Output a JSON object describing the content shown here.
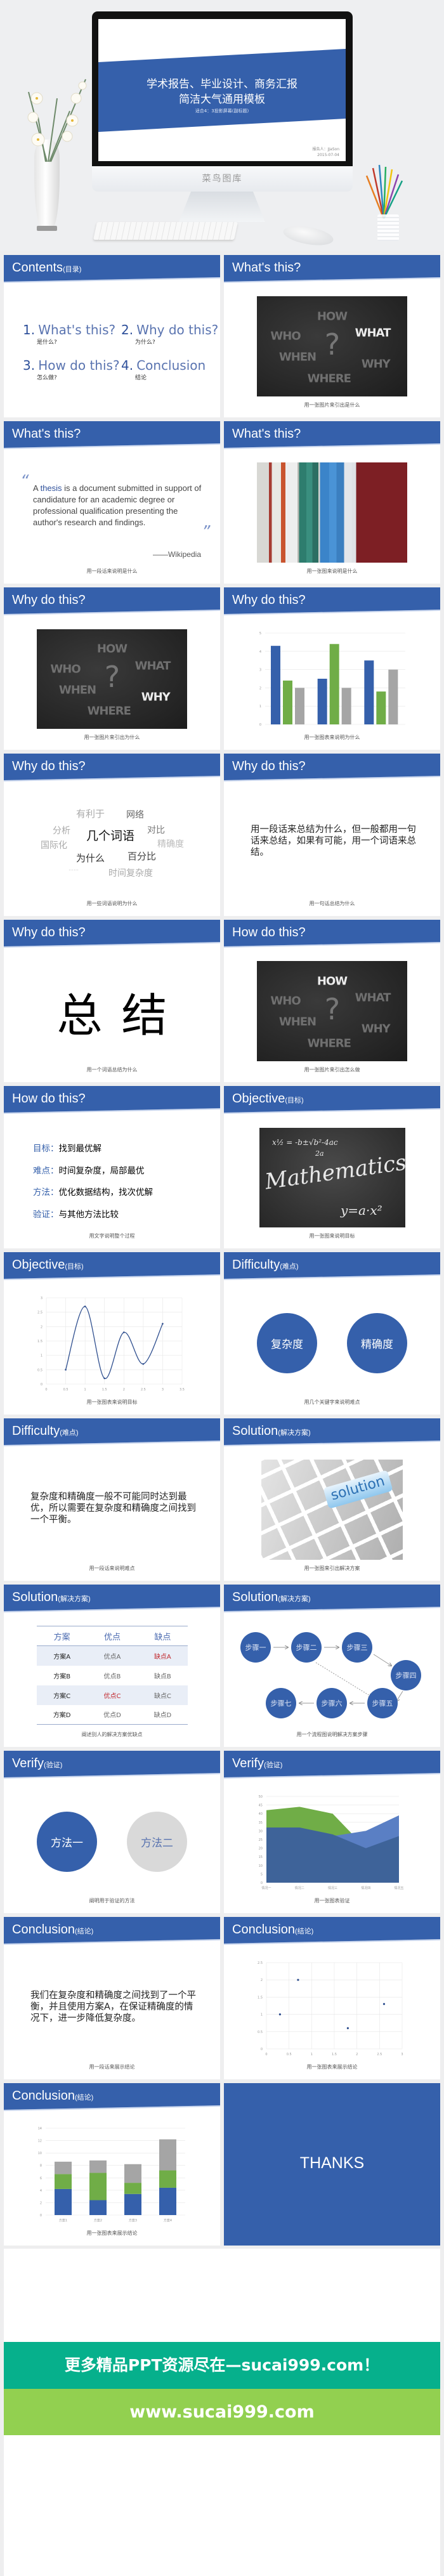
{
  "hero": {
    "title_line1": "学术报告、毕业设计、商务汇报",
    "title_line2": "简洁大气通用模板",
    "subtitle": "适合4：3投影屏幕(副标题)",
    "presenter": "报告人：JJaSon",
    "date": "2015-07-04",
    "brand": "菜鸟图库"
  },
  "colors": {
    "accent": "#3560ab",
    "green": "#70ad47",
    "gray": "#a5a5a5",
    "highlight_red": "#c0282d",
    "banner_teal": "#06b08c",
    "banner_lime": "#92d050"
  },
  "board_words": {
    "how": "HOW",
    "who": "WHO",
    "what": "WHAT",
    "when": "WHEN",
    "why": "WHY",
    "where": "WHERE",
    "q": "?"
  },
  "slides": [
    {
      "title": "Contents",
      "title_sub": "(目录)",
      "items": [
        {
          "num": "1.",
          "label": "What's this?",
          "sub": "是什么?"
        },
        {
          "num": "2.",
          "label": "Why do this?",
          "sub": "为什么?"
        },
        {
          "num": "3.",
          "label": "How do this?",
          "sub": "怎么做?"
        },
        {
          "num": "4.",
          "label": "Conclusion",
          "sub": "结论"
        }
      ]
    },
    {
      "title": "What's this?",
      "caption": "用一张图片来引出是什么"
    },
    {
      "title": "What's this?",
      "quote_open": "“",
      "quote_pre": "A ",
      "quote_term": "thesis",
      "quote_rest": " is a document submitted in support of candidature for an academic degree or professional qualification presenting the author's research and findings.",
      "quote_close": "”",
      "source": "——Wikipedia",
      "caption": "用一段话来说明是什么"
    },
    {
      "title": "What's this?",
      "caption": "用一张图来说明是什么"
    },
    {
      "title": "Why do this?",
      "caption": "用一张图片来引出为什么"
    },
    {
      "title": "Why do this?",
      "caption": "用一张图表来说明为什么"
    },
    {
      "title": "Why do this?",
      "caption": "用一些词语说明为什么",
      "words": [
        "有利于",
        "网络",
        "分析",
        "几个词语",
        "对比",
        "精确度",
        "国际化",
        "为什么",
        "百分比",
        "……",
        "时间复杂度"
      ]
    },
    {
      "title": "Why do this?",
      "paragraph": "用一段话来总结为什么，但一般都用一句话来总结，如果有可能，用一个词语来总结。",
      "caption": "用一句话总结为什么"
    },
    {
      "title": "Why do this?",
      "big_word": "总结",
      "caption": "用一个词语总结为什么"
    },
    {
      "title": "How do this?",
      "caption": "用一张图片来引出怎么做"
    },
    {
      "title": "How do this?",
      "list": [
        {
          "label": "目标：",
          "text": "找到最优解"
        },
        {
          "label": "难点：",
          "text": "时间复杂度，局部最优"
        },
        {
          "label": "方法：",
          "text": "优化数据结构，找次优解"
        },
        {
          "label": "验证：",
          "text": "与其他方法比较"
        }
      ],
      "caption": "用文字说明整个过程"
    },
    {
      "title": "Objective",
      "title_sub": "(目标)",
      "caption": "用一张图来说明目标",
      "board_text": {
        "formula1": "x½ = -b±√b²-4ac",
        "formula1b": "2a",
        "main": "Mathematics",
        "formula2": "y=a·x²"
      }
    },
    {
      "title": "Objective",
      "title_sub": "(目标)",
      "caption": "用一张图表来说明目标"
    },
    {
      "title": "Difficulty",
      "title_sub": "(难点)",
      "keywords": [
        "复杂度",
        "精确度"
      ],
      "caption": "用几个关键字来说明难点"
    },
    {
      "title": "Difficulty",
      "title_sub": "(难点)",
      "paragraph": "复杂度和精确度一般不可能同时达到最优，所以需要在复杂度和精确度之间找到一个平衡。",
      "caption": "用一段话来说明难点"
    },
    {
      "title": "Solution",
      "title_sub": "(解决方案)",
      "image_text": "solution",
      "caption": "用一张图来引出解决方案"
    },
    {
      "title": "Solution",
      "title_sub": "(解决方案)",
      "table": {
        "headers": [
          "方案",
          "优点",
          "缺点"
        ],
        "rows": [
          [
            "方案A",
            "优点A",
            "缺点A"
          ],
          [
            "方案B",
            "优点B",
            "缺点B"
          ],
          [
            "方案C",
            "优点C",
            "缺点C"
          ],
          [
            "方案D",
            "优点D",
            "缺点D"
          ]
        ]
      },
      "caption": "阐述别人的解决方案优缺点"
    },
    {
      "title": "Solution",
      "title_sub": "(解决方案)",
      "steps": [
        "步骤一",
        "步骤二",
        "步骤三",
        "步骤四",
        "步骤五",
        "步骤六",
        "步骤七"
      ],
      "caption": "用一个流程图说明解决方案步骤"
    },
    {
      "title": "Verify",
      "title_sub": "(验证)",
      "methods": [
        "方法一",
        "方法二"
      ],
      "caption": "阐明用于验证的方法"
    },
    {
      "title": "Verify",
      "title_sub": "(验证)",
      "caption": "用一张图表验证"
    },
    {
      "title": "Conclusion",
      "title_sub": "(结论)",
      "paragraph": "我们在复杂度和精确度之间找到了一个平衡，并且使用方案A，在保证精确度的情况下，进一步降低复杂度。",
      "caption": "用一段话来展示结论"
    },
    {
      "title": "Conclusion",
      "title_sub": "(结论)",
      "caption": "用一张图表来展示结论"
    },
    {
      "title": "Conclusion",
      "title_sub": "(结论)",
      "caption": "用一张图表来展示结论"
    },
    {
      "thanks": "THANKS"
    }
  ],
  "chart_data": [
    {
      "type": "bar",
      "categories": [
        "",
        "",
        ""
      ],
      "ylim": [
        0,
        5
      ],
      "yticks": [
        0,
        1,
        2,
        3,
        4,
        5
      ],
      "grid": true,
      "series": [
        {
          "color": "#3560ab",
          "values": [
            4.3,
            2.5,
            3.5
          ]
        },
        {
          "color": "#70ad47",
          "values": [
            2.4,
            4.4,
            1.8
          ]
        },
        {
          "color": "#a5a5a5",
          "values": [
            2.0,
            2.0,
            3.0
          ]
        }
      ]
    },
    {
      "type": "line",
      "smooth": true,
      "x": [
        0.5,
        1,
        1.5,
        2,
        2.5,
        3
      ],
      "y": [
        0.5,
        2.7,
        0.2,
        1.8,
        0.7,
        2.1
      ],
      "xlim": [
        0,
        3.5
      ],
      "ylim": [
        0,
        3
      ],
      "xticks": [
        0,
        0.5,
        1,
        1.5,
        2,
        2.5,
        3,
        3.5
      ],
      "yticks": [
        0,
        0.5,
        1,
        1.5,
        2,
        2.5,
        3
      ],
      "grid": true,
      "color": "#2f4f8f"
    },
    {
      "type": "area",
      "categories": [
        "情况一",
        "情况二",
        "情况三",
        "情况四",
        "情况五"
      ],
      "ylim": [
        0,
        50
      ],
      "yticks": [
        0,
        5,
        10,
        15,
        20,
        25,
        30,
        35,
        40,
        45,
        50
      ],
      "grid": true,
      "series": [
        {
          "color": "#70ad47",
          "values": [
            42,
            44,
            40,
            20,
            25
          ]
        },
        {
          "color": "#5a7fc4",
          "values": [
            30,
            30,
            27,
            30,
            39
          ]
        },
        {
          "color": "#3e6399",
          "values": [
            32,
            32,
            28,
            20,
            27
          ]
        }
      ]
    },
    {
      "type": "scatter",
      "points": [
        [
          0.3,
          1.0
        ],
        [
          0.7,
          2.0
        ],
        [
          1.8,
          0.6
        ],
        [
          2.6,
          1.3
        ]
      ],
      "xlim": [
        0,
        3
      ],
      "ylim": [
        0,
        2.5
      ],
      "xticks": [
        0,
        0.5,
        1,
        1.5,
        2,
        2.5,
        3
      ],
      "yticks": [
        0,
        0.5,
        1,
        1.5,
        2,
        2.5
      ],
      "grid": true,
      "color": "#2f4f8f"
    },
    {
      "type": "bar",
      "stacked": true,
      "categories": [
        "方案1",
        "方案2",
        "方案3",
        "方案4"
      ],
      "ylim": [
        0,
        14
      ],
      "yticks": [
        0,
        2,
        4,
        6,
        8,
        10,
        12,
        14
      ],
      "grid": true,
      "series": [
        {
          "color": "#3560ab",
          "values": [
            4.2,
            2.4,
            3.4,
            4.4
          ]
        },
        {
          "color": "#70ad47",
          "values": [
            2.4,
            4.4,
            1.8,
            2.8
          ]
        },
        {
          "color": "#a5a5a5",
          "values": [
            2.0,
            2.0,
            3.0,
            5.0
          ]
        }
      ]
    }
  ],
  "banner": {
    "line1": "更多精品PPT资源尽在—sucai999.com！",
    "line2": "www.sucai999.com"
  }
}
